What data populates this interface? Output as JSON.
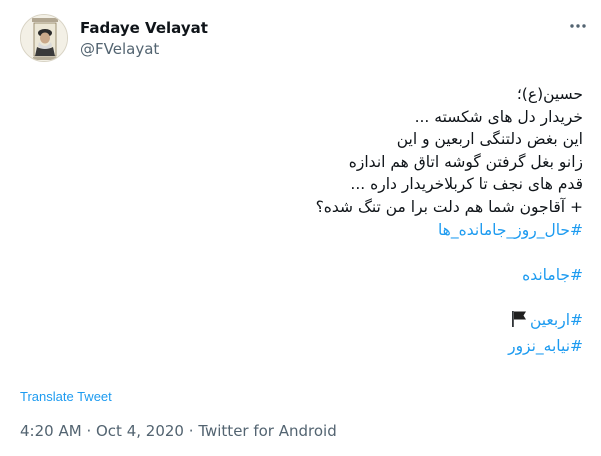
{
  "author": {
    "display_name": "Fadaye Velayat",
    "handle": "@FVelayat",
    "avatar_icon": "portrait-avatar"
  },
  "more_icon": "more-dots-icon",
  "tweet": {
    "lines": [
      "حسین(ع)؛",
      "خریدار دل های شکسته ...",
      "این بغض دلتنگی اربعین و این",
      "زانو بغل گرفتن گوشه اتاق هم اندازه",
      "قدم های نجف تا کربلاخریدار داره ...",
      "+ آقاجون شما هم دلت برا من تنگ شده؟"
    ],
    "hashtags": {
      "h1": "#حال_روز_جامانده_ها",
      "h2": "#جامانده",
      "h3": "#اربعین",
      "h4": "#نیابه_نزور"
    },
    "flag_icon": "black-flag-emoji"
  },
  "translate_label": "Translate Tweet",
  "meta": {
    "time": "4:20 AM",
    "separator": "·",
    "date": "Oct 4, 2020",
    "source": "Twitter for Android"
  },
  "colors": {
    "link": "#1d9bf0",
    "secondary_text": "#536471",
    "primary_text": "#0f1419"
  }
}
